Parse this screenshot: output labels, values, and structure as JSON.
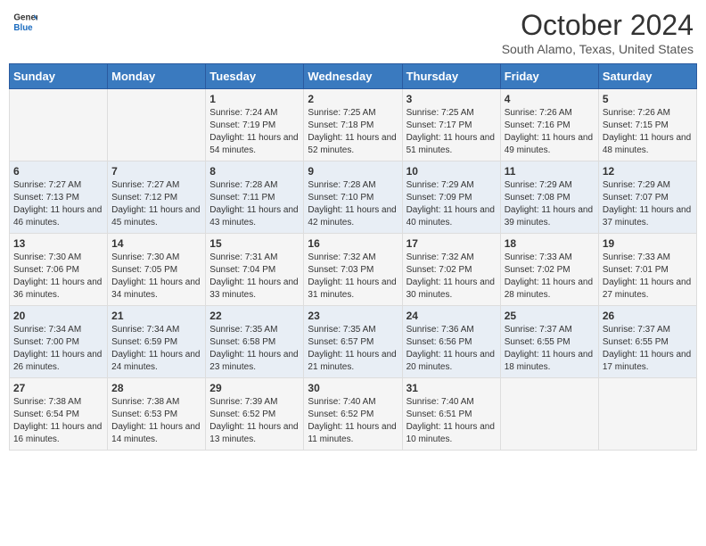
{
  "header": {
    "logo_general": "General",
    "logo_blue": "Blue",
    "title": "October 2024",
    "location": "South Alamo, Texas, United States"
  },
  "days_of_week": [
    "Sunday",
    "Monday",
    "Tuesday",
    "Wednesday",
    "Thursday",
    "Friday",
    "Saturday"
  ],
  "weeks": [
    [
      {
        "day": "",
        "content": ""
      },
      {
        "day": "",
        "content": ""
      },
      {
        "day": "1",
        "content": "Sunrise: 7:24 AM\nSunset: 7:19 PM\nDaylight: 11 hours and 54 minutes."
      },
      {
        "day": "2",
        "content": "Sunrise: 7:25 AM\nSunset: 7:18 PM\nDaylight: 11 hours and 52 minutes."
      },
      {
        "day": "3",
        "content": "Sunrise: 7:25 AM\nSunset: 7:17 PM\nDaylight: 11 hours and 51 minutes."
      },
      {
        "day": "4",
        "content": "Sunrise: 7:26 AM\nSunset: 7:16 PM\nDaylight: 11 hours and 49 minutes."
      },
      {
        "day": "5",
        "content": "Sunrise: 7:26 AM\nSunset: 7:15 PM\nDaylight: 11 hours and 48 minutes."
      }
    ],
    [
      {
        "day": "6",
        "content": "Sunrise: 7:27 AM\nSunset: 7:13 PM\nDaylight: 11 hours and 46 minutes."
      },
      {
        "day": "7",
        "content": "Sunrise: 7:27 AM\nSunset: 7:12 PM\nDaylight: 11 hours and 45 minutes."
      },
      {
        "day": "8",
        "content": "Sunrise: 7:28 AM\nSunset: 7:11 PM\nDaylight: 11 hours and 43 minutes."
      },
      {
        "day": "9",
        "content": "Sunrise: 7:28 AM\nSunset: 7:10 PM\nDaylight: 11 hours and 42 minutes."
      },
      {
        "day": "10",
        "content": "Sunrise: 7:29 AM\nSunset: 7:09 PM\nDaylight: 11 hours and 40 minutes."
      },
      {
        "day": "11",
        "content": "Sunrise: 7:29 AM\nSunset: 7:08 PM\nDaylight: 11 hours and 39 minutes."
      },
      {
        "day": "12",
        "content": "Sunrise: 7:29 AM\nSunset: 7:07 PM\nDaylight: 11 hours and 37 minutes."
      }
    ],
    [
      {
        "day": "13",
        "content": "Sunrise: 7:30 AM\nSunset: 7:06 PM\nDaylight: 11 hours and 36 minutes."
      },
      {
        "day": "14",
        "content": "Sunrise: 7:30 AM\nSunset: 7:05 PM\nDaylight: 11 hours and 34 minutes."
      },
      {
        "day": "15",
        "content": "Sunrise: 7:31 AM\nSunset: 7:04 PM\nDaylight: 11 hours and 33 minutes."
      },
      {
        "day": "16",
        "content": "Sunrise: 7:32 AM\nSunset: 7:03 PM\nDaylight: 11 hours and 31 minutes."
      },
      {
        "day": "17",
        "content": "Sunrise: 7:32 AM\nSunset: 7:02 PM\nDaylight: 11 hours and 30 minutes."
      },
      {
        "day": "18",
        "content": "Sunrise: 7:33 AM\nSunset: 7:02 PM\nDaylight: 11 hours and 28 minutes."
      },
      {
        "day": "19",
        "content": "Sunrise: 7:33 AM\nSunset: 7:01 PM\nDaylight: 11 hours and 27 minutes."
      }
    ],
    [
      {
        "day": "20",
        "content": "Sunrise: 7:34 AM\nSunset: 7:00 PM\nDaylight: 11 hours and 26 minutes."
      },
      {
        "day": "21",
        "content": "Sunrise: 7:34 AM\nSunset: 6:59 PM\nDaylight: 11 hours and 24 minutes."
      },
      {
        "day": "22",
        "content": "Sunrise: 7:35 AM\nSunset: 6:58 PM\nDaylight: 11 hours and 23 minutes."
      },
      {
        "day": "23",
        "content": "Sunrise: 7:35 AM\nSunset: 6:57 PM\nDaylight: 11 hours and 21 minutes."
      },
      {
        "day": "24",
        "content": "Sunrise: 7:36 AM\nSunset: 6:56 PM\nDaylight: 11 hours and 20 minutes."
      },
      {
        "day": "25",
        "content": "Sunrise: 7:37 AM\nSunset: 6:55 PM\nDaylight: 11 hours and 18 minutes."
      },
      {
        "day": "26",
        "content": "Sunrise: 7:37 AM\nSunset: 6:55 PM\nDaylight: 11 hours and 17 minutes."
      }
    ],
    [
      {
        "day": "27",
        "content": "Sunrise: 7:38 AM\nSunset: 6:54 PM\nDaylight: 11 hours and 16 minutes."
      },
      {
        "day": "28",
        "content": "Sunrise: 7:38 AM\nSunset: 6:53 PM\nDaylight: 11 hours and 14 minutes."
      },
      {
        "day": "29",
        "content": "Sunrise: 7:39 AM\nSunset: 6:52 PM\nDaylight: 11 hours and 13 minutes."
      },
      {
        "day": "30",
        "content": "Sunrise: 7:40 AM\nSunset: 6:52 PM\nDaylight: 11 hours and 11 minutes."
      },
      {
        "day": "31",
        "content": "Sunrise: 7:40 AM\nSunset: 6:51 PM\nDaylight: 11 hours and 10 minutes."
      },
      {
        "day": "",
        "content": ""
      },
      {
        "day": "",
        "content": ""
      }
    ]
  ]
}
